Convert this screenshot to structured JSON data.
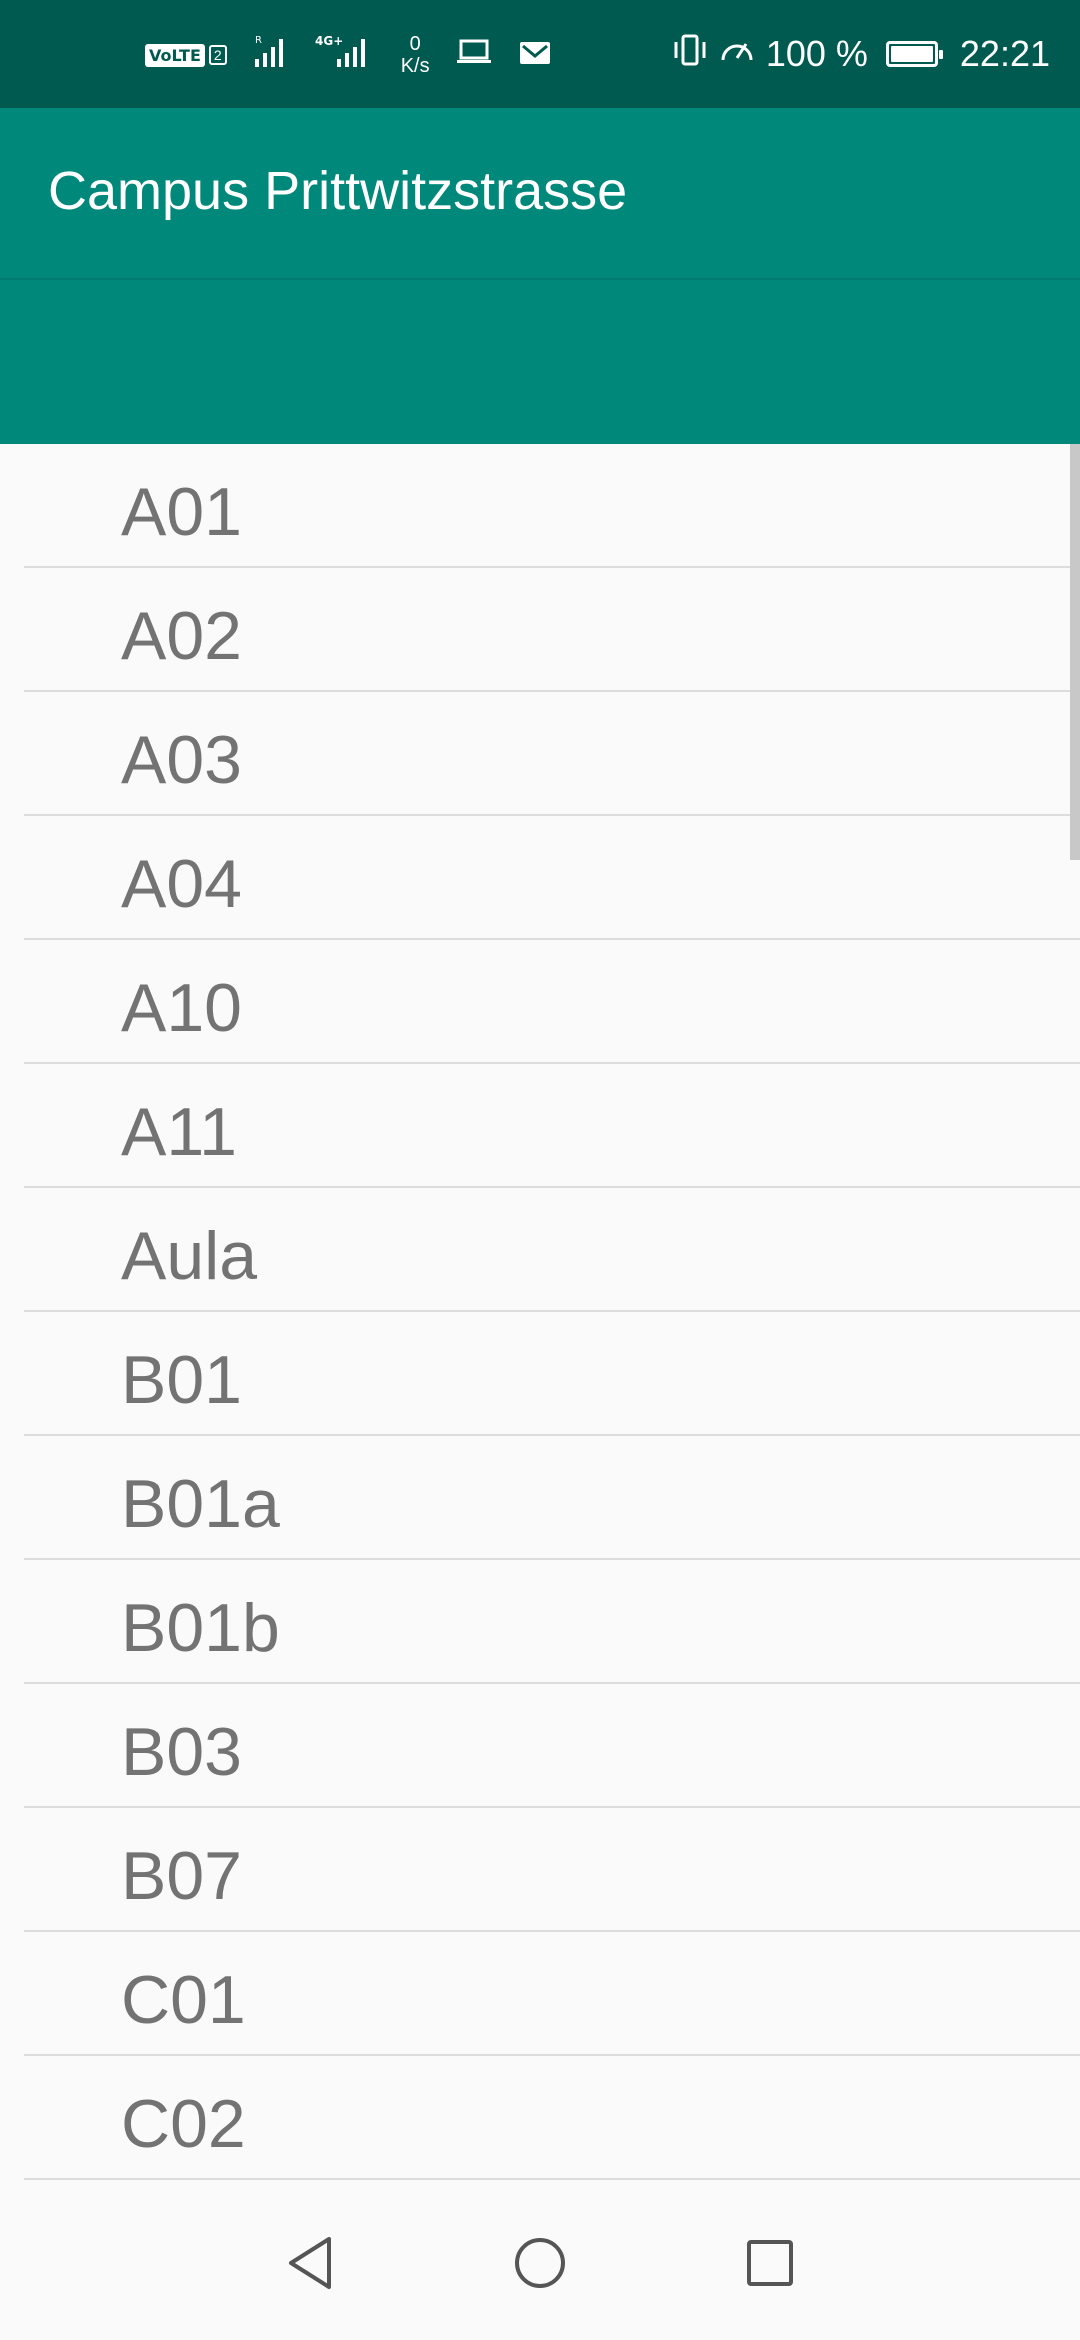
{
  "status_bar": {
    "volte_label": "VoLTE",
    "sim_label": "2",
    "net_speed_value": "0",
    "net_speed_unit": "K/s",
    "battery_percent": "100 %",
    "battery_level": 1.0,
    "time": "22:21",
    "icons": [
      "volte-icon",
      "signal-icon",
      "signal-4g-icon",
      "laptop-icon",
      "mail-icon",
      "vibrate-icon",
      "speedometer-icon",
      "battery-icon"
    ]
  },
  "app_bar": {
    "title": "Campus Prittwitzstrasse"
  },
  "colors": {
    "status_bar": "#005a4f",
    "app_bar": "#00897b",
    "list_text": "#737373",
    "divider": "#dcdcdc",
    "background": "#fafafa"
  },
  "rooms": [
    {
      "label": "A01"
    },
    {
      "label": "A02"
    },
    {
      "label": "A03"
    },
    {
      "label": "A04"
    },
    {
      "label": "A10"
    },
    {
      "label": "A11"
    },
    {
      "label": "Aula"
    },
    {
      "label": "B01"
    },
    {
      "label": "B01a"
    },
    {
      "label": "B01b"
    },
    {
      "label": "B03"
    },
    {
      "label": "B07"
    },
    {
      "label": "C01"
    },
    {
      "label": "C02"
    }
  ],
  "nav_bar": {
    "icons": [
      "back-icon",
      "home-icon",
      "recents-icon"
    ]
  }
}
